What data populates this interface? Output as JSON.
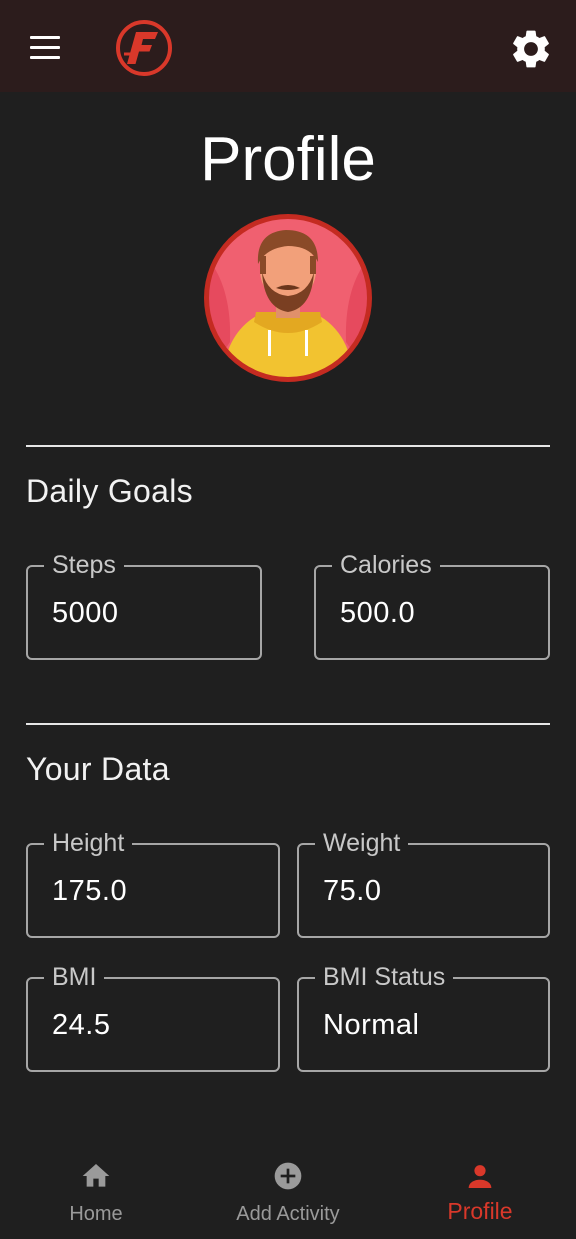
{
  "colors": {
    "appbar_bg": "#2c1c1c",
    "background": "#1f1f1f",
    "accent": "#d9382a",
    "field_border": "#a6a6a6",
    "nav_inactive": "#9a9a9a"
  },
  "appbar": {
    "menu_icon": "hamburger-menu-icon",
    "logo_icon": "app-logo-f",
    "settings_icon": "gear-icon"
  },
  "page": {
    "title": "Profile"
  },
  "daily_goals": {
    "title": "Daily Goals",
    "steps": {
      "label": "Steps",
      "value": "5000"
    },
    "calories": {
      "label": "Calories",
      "value": "500.0"
    }
  },
  "your_data": {
    "title": "Your Data",
    "height": {
      "label": "Height",
      "value": "175.0"
    },
    "weight": {
      "label": "Weight",
      "value": "75.0"
    },
    "bmi": {
      "label": "BMI",
      "value": "24.5"
    },
    "bmi_status": {
      "label": "BMI Status",
      "value": "Normal"
    }
  },
  "bottom_nav": {
    "items": [
      {
        "label": "Home",
        "icon": "home-icon",
        "active": false
      },
      {
        "label": "Add Activity",
        "icon": "add-circle-icon",
        "active": false
      },
      {
        "label": "Profile",
        "icon": "person-icon",
        "active": true
      }
    ]
  }
}
